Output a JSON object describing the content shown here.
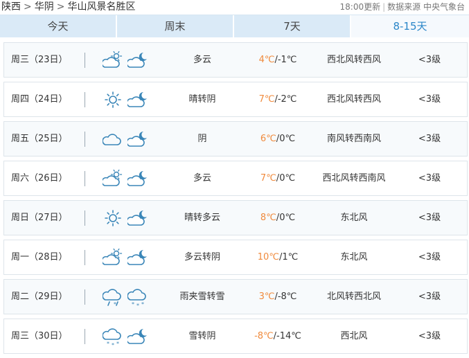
{
  "breadcrumb": [
    "陕西",
    "华阴",
    "华山风景名胜区"
  ],
  "breadcrumb_sep": ">",
  "update_time": "18:00更新",
  "source_label": "数据来源 中央气象台",
  "tabs": [
    {
      "label": "今天",
      "active": false
    },
    {
      "label": "周末",
      "active": false
    },
    {
      "label": "7天",
      "active": false
    },
    {
      "label": "8-15天",
      "active": true
    }
  ],
  "temp_sep": "/",
  "colors": {
    "accent": "#2a86c8",
    "high_temp": "#f08a3c",
    "icon": "#3a86b8",
    "tab_bg": "#daeaf7"
  },
  "days": [
    {
      "date": "周三（23日）",
      "icon_day": "partly-cloudy-day-icon",
      "icon_night": "partly-cloudy-night-icon",
      "desc": "多云",
      "high": "4℃",
      "low": "-1℃",
      "wind": "西北风转西风",
      "level": "<3级"
    },
    {
      "date": "周四（24日）",
      "icon_day": "sunny-icon",
      "icon_night": "partly-cloudy-night-icon",
      "desc": "晴转阴",
      "high": "7℃",
      "low": "-2℃",
      "wind": "西北风转西风",
      "level": "<3级"
    },
    {
      "date": "周五（25日）",
      "icon_day": "overcast-icon",
      "icon_night": "partly-cloudy-night-icon",
      "desc": "阴",
      "high": "6℃",
      "low": "0℃",
      "wind": "南风转西南风",
      "level": "<3级"
    },
    {
      "date": "周六（26日）",
      "icon_day": "partly-cloudy-day-icon",
      "icon_night": "partly-cloudy-night-icon",
      "desc": "多云",
      "high": "7℃",
      "low": "0℃",
      "wind": "西北风转西南风",
      "level": "<3级"
    },
    {
      "date": "周日（27日）",
      "icon_day": "sunny-icon",
      "icon_night": "partly-cloudy-night-icon",
      "desc": "晴转多云",
      "high": "8℃",
      "low": "0℃",
      "wind": "东北风",
      "level": "<3级"
    },
    {
      "date": "周一（28日）",
      "icon_day": "partly-cloudy-day-icon",
      "icon_night": "partly-cloudy-night-icon",
      "desc": "多云转阴",
      "high": "10℃",
      "low": "1℃",
      "wind": "东北风",
      "level": "<3级"
    },
    {
      "date": "周二（29日）",
      "icon_day": "sleet-icon",
      "icon_night": "snow-icon",
      "desc": "雨夹雪转雪",
      "high": "3℃",
      "low": "-8℃",
      "wind": "北风转西北风",
      "level": "<3级"
    },
    {
      "date": "周三（30日）",
      "icon_day": "snow-icon",
      "icon_night": "partly-cloudy-night-icon",
      "desc": "雪转阴",
      "high": "-8℃",
      "low": "-14℃",
      "wind": "西北风",
      "level": "<3级"
    }
  ]
}
